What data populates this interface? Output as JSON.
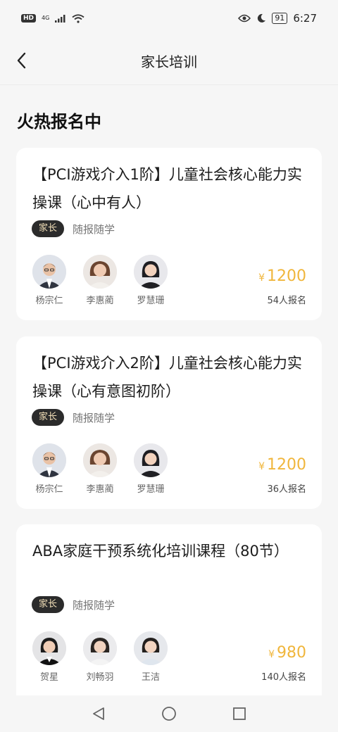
{
  "status_bar": {
    "hd": "HD",
    "network": "4G",
    "time": "6:27",
    "battery": "91"
  },
  "nav": {
    "title": "家长培训"
  },
  "section": {
    "title": "火热报名中"
  },
  "courses": [
    {
      "title": "【PCI游戏介入1阶】儿童社会核心能力实操课（心中有人）",
      "tag": "家长",
      "mode": "随报随学",
      "teachers": [
        {
          "name": "杨宗仁"
        },
        {
          "name": "李惠蔺"
        },
        {
          "name": "罗慧珊"
        }
      ],
      "currency": "¥",
      "price": "1200",
      "signups": "54人报名"
    },
    {
      "title": "【PCI游戏介入2阶】儿童社会核心能力实操课（心有意图初阶）",
      "tag": "家长",
      "mode": "随报随学",
      "teachers": [
        {
          "name": "杨宗仁"
        },
        {
          "name": "李惠蔺"
        },
        {
          "name": "罗慧珊"
        }
      ],
      "currency": "¥",
      "price": "1200",
      "signups": "36人报名"
    },
    {
      "title": "ABA家庭干预系统化培训课程（80节）",
      "tag": "家长",
      "mode": "随报随学",
      "teachers": [
        {
          "name": "贺星"
        },
        {
          "name": "刘畅羽"
        },
        {
          "name": "王洁"
        }
      ],
      "currency": "¥",
      "price": "980",
      "signups": "140人报名"
    }
  ],
  "colors": {
    "accent_price": "#f0b63c",
    "tag_bg": "#2b2b2b",
    "tag_text": "#f2dfb8",
    "page_bg": "#f6f6f6"
  }
}
